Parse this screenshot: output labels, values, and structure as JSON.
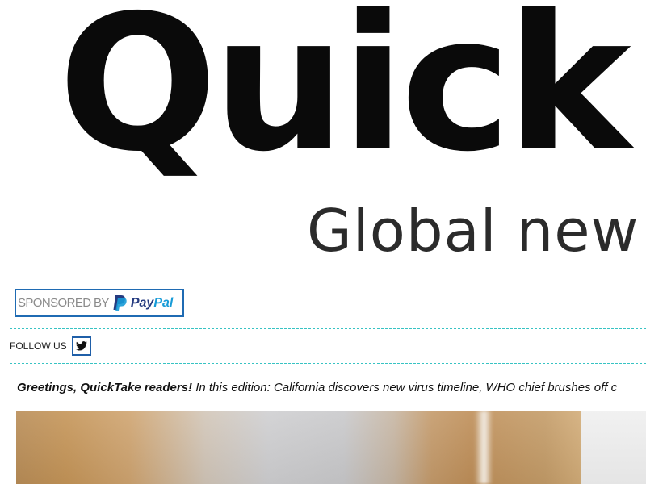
{
  "masthead": {
    "brand": "Quick",
    "tagline": "Global new"
  },
  "sponsor": {
    "label": "SPONSORED BY",
    "brand_part1": "Pay",
    "brand_part2": "Pal"
  },
  "follow": {
    "label": "FOLLOW US",
    "icon": "twitter-icon"
  },
  "intro": {
    "greeting": "Greetings, QuickTake readers!",
    "text": " In this edition: California discovers new virus timeline, WHO chief brushes off c"
  },
  "colors": {
    "accent_dashes": "#37c3c3",
    "badge_border": "#1f6bb3",
    "paypal_dark": "#253b80",
    "paypal_light": "#179bd7"
  }
}
